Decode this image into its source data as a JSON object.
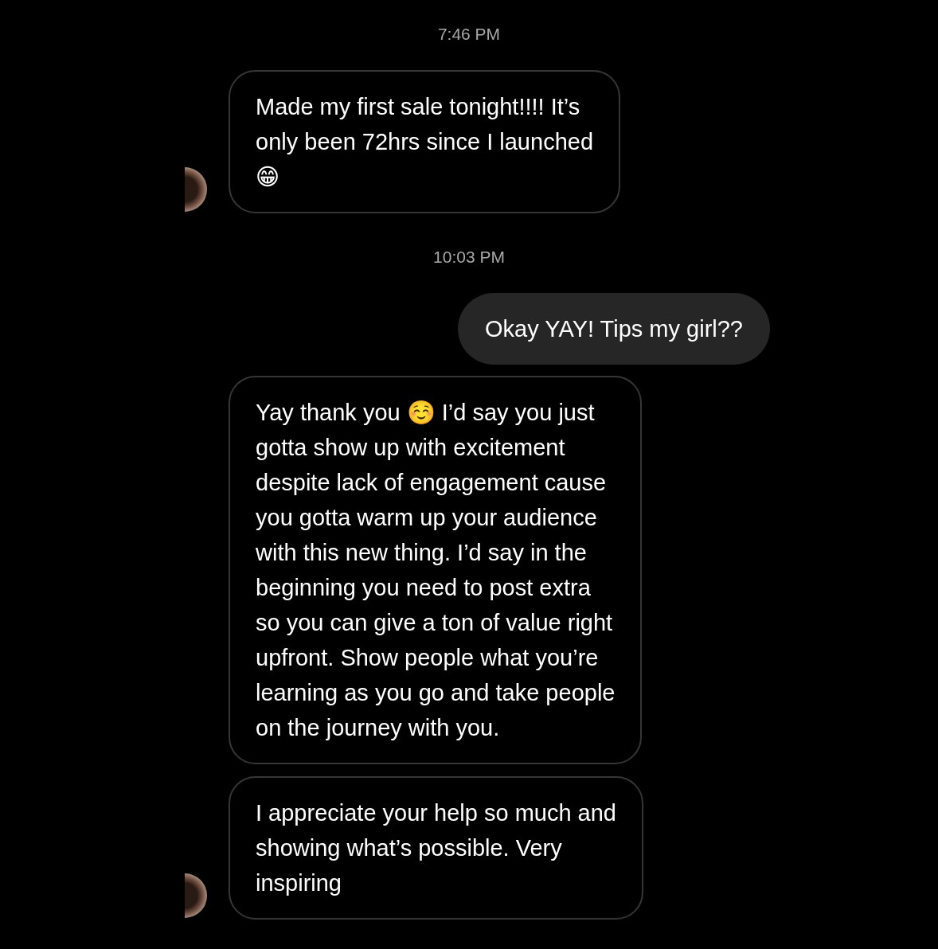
{
  "messages": [
    {
      "kind": "timestamp",
      "text": "7:46 PM"
    },
    {
      "kind": "received",
      "text": "Made my first sale tonight!!!! It’s\nonly been 72hrs since I launched\n😁",
      "avatar": true
    },
    {
      "kind": "timestamp",
      "text": "10:03 PM"
    },
    {
      "kind": "sent",
      "text": "Okay YAY! Tips my girl??"
    },
    {
      "kind": "received",
      "text": "Yay thank you ☺️ I’d say you just\ngotta show up with excitement\ndespite lack of engagement cause\nyou gotta warm up your audience\nwith this new thing. I’d say in the\nbeginning you need to post extra\nso you can give a ton of value right\nupfront. Show people what you’re\nlearning as you go and take people\non the journey with you.",
      "avatar": false
    },
    {
      "kind": "received",
      "text": "I appreciate your help so much and\nshowing what’s possible. Very\ninspiring",
      "avatar": true
    }
  ]
}
